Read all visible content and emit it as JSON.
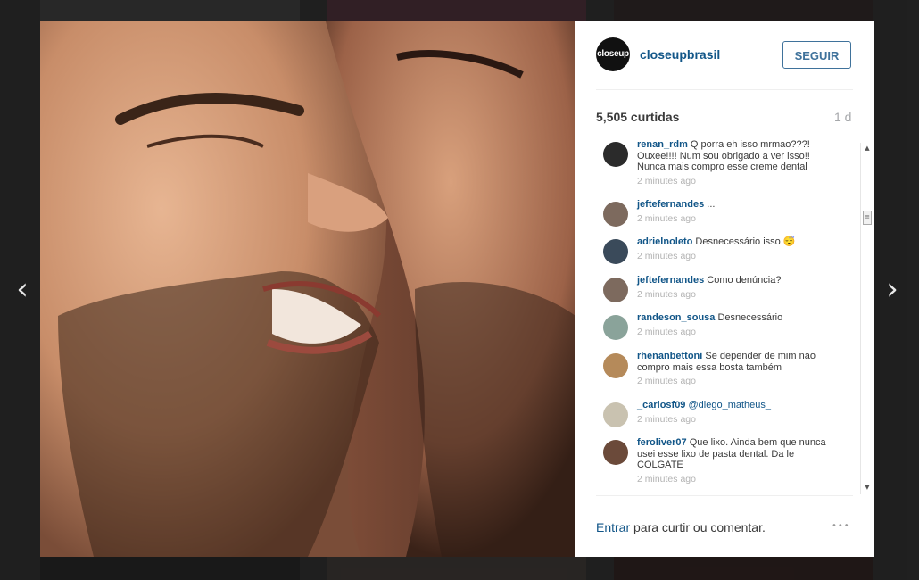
{
  "post": {
    "username": "closeupbrasil",
    "avatar_text": "closeup",
    "follow_label": "SEGUIR",
    "likes": "5,505 curtidas",
    "time": "1 d"
  },
  "comments": [
    {
      "user": "renan_rdm",
      "text": "Q porra eh isso mrmao???! Ouxee!!!! Num sou obrigado a ver isso!! Nunca mais compro esse creme dental",
      "time": "2 minutes ago",
      "avatar_color": "#2b2b2b"
    },
    {
      "user": "jeftefernandes",
      "text": "...",
      "time": "2 minutes ago",
      "avatar_color": "#7d6a5e"
    },
    {
      "user": "adrielnoleto",
      "text": "Desnecessário isso 😴",
      "time": "2 minutes ago",
      "avatar_color": "#3a4a5a"
    },
    {
      "user": "jeftefernandes",
      "text": "Como denúncia?",
      "time": "2 minutes ago",
      "avatar_color": "#7d6a5e"
    },
    {
      "user": "randeson_sousa",
      "text": "Desnecessário",
      "time": "2 minutes ago",
      "avatar_color": "#8aa39a"
    },
    {
      "user": "rhenanbettoni",
      "text": "Se depender de mim nao compro mais essa bosta também",
      "time": "2 minutes ago",
      "avatar_color": "#b58a5a"
    },
    {
      "user": "_carlosf09",
      "text": "@diego_matheus_",
      "time": "2 minutes ago",
      "avatar_color": "#c9c2b0"
    },
    {
      "user": "feroliver07",
      "text": "Que lixo. Ainda bem que nunca usei esse lixo de pasta dental. Da le COLGATE",
      "time": "2 minutes ago",
      "avatar_color": "#6b4a3a"
    }
  ],
  "footer": {
    "login_link": "Entrar",
    "login_text": " para curtir ou comentar.",
    "more_icon": "•••"
  },
  "nav": {
    "prev": "‹",
    "next": "›"
  },
  "scroll": {
    "up": "▲",
    "down": "▼",
    "thumb": "≡"
  }
}
